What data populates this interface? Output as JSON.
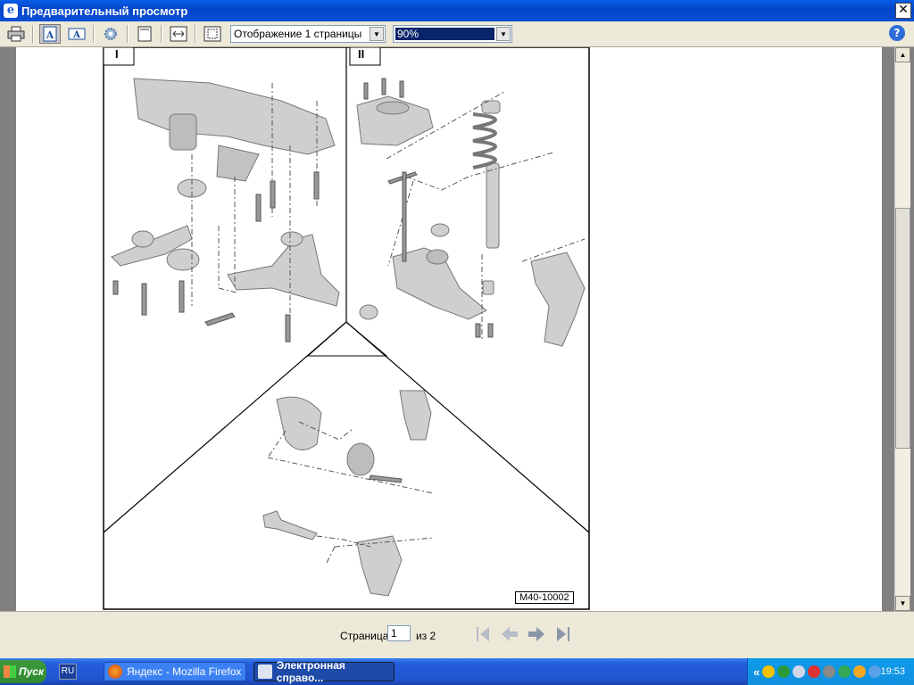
{
  "window": {
    "title": "Предварительный просмотр",
    "close_label": "✕"
  },
  "toolbar": {
    "view_mode": "Отображение 1 страницы",
    "zoom": "90%",
    "help_label": "?"
  },
  "diagram": {
    "section_labels": [
      "I",
      "II"
    ],
    "ref_code": "M40-10002"
  },
  "pager": {
    "page_label": "Страница",
    "current_page": "1",
    "of_label": "из 2"
  },
  "taskbar": {
    "start_label": "Пуск",
    "lang": "RU",
    "tasks": [
      {
        "label": "Яндекс - Mozilla Firefox"
      },
      {
        "label": "Электронная справо..."
      }
    ],
    "tray_expand": "«",
    "clock": "19:53"
  },
  "colors": {
    "accent": "#0a246a",
    "titlebar": "#0346c9",
    "taskbar": "#245edb"
  }
}
